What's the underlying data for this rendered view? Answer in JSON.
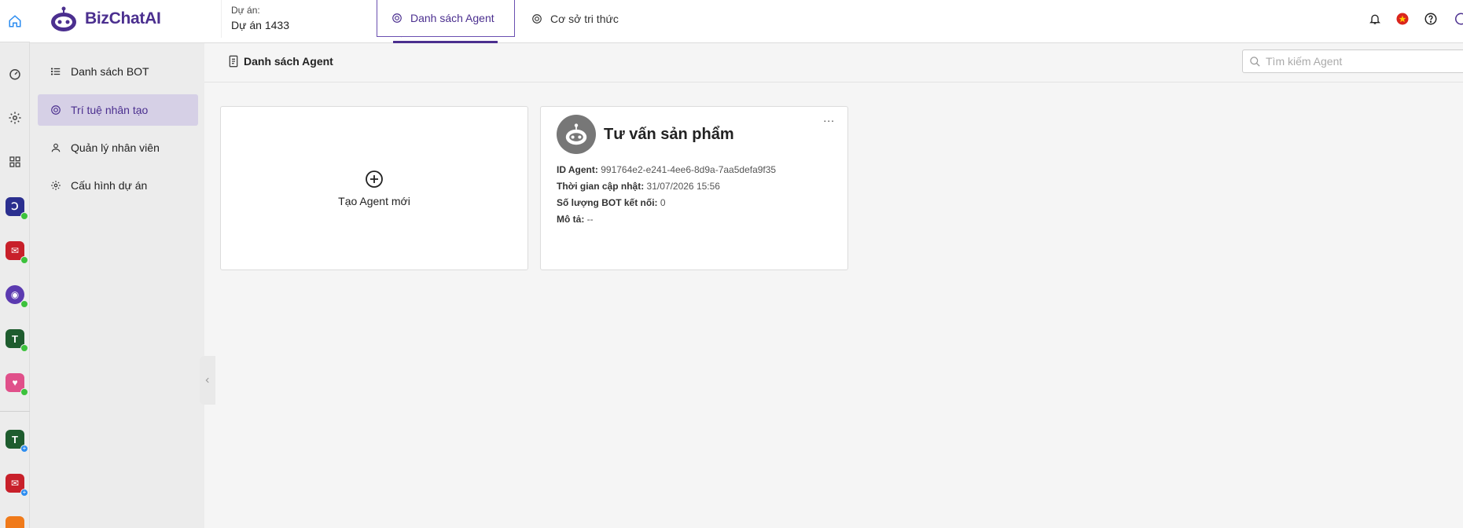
{
  "app": {
    "brand": "BizChatAI",
    "brand_prefix": "Biz",
    "brand_suffix": "ChatAI",
    "accent": "#4b2f8f"
  },
  "topbar": {
    "project_label": "Dự án:",
    "project_name": "Dự án 1433",
    "tabs": [
      {
        "label": "Danh sách Agent",
        "icon": "openai-icon",
        "active": true
      },
      {
        "label": "Cơ sở tri thức",
        "icon": "openai-icon",
        "active": false
      }
    ],
    "right_icons": [
      "bell-icon",
      "vietnam-flag-icon",
      "help-icon",
      "user-icon"
    ]
  },
  "rail": {
    "icons": [
      "home-icon",
      "dashboard-icon",
      "settings-icon",
      "grid-icon",
      "app-icon",
      "app-icon",
      "app-icon",
      "app-icon",
      "app-icon",
      "app-icon",
      "app-icon",
      "app-icon"
    ]
  },
  "sidebar": {
    "items": [
      {
        "label": "Danh sách BOT",
        "icon": "list-icon",
        "active": false
      },
      {
        "label": "Trí tuệ nhân tạo",
        "icon": "openai-icon",
        "active": true
      },
      {
        "label": "Quản lý nhân viên",
        "icon": "user-icon",
        "active": false
      },
      {
        "label": "Cấu hình dự án",
        "icon": "gear-icon",
        "active": false
      }
    ]
  },
  "main": {
    "title": "Danh sách Agent",
    "search_placeholder": "Tìm kiếm Agent",
    "new_agent_label": "Tạo Agent mới",
    "agents": [
      {
        "name": "Tư vấn sản phẩm",
        "id_label": "ID Agent:",
        "id_value": "991764e2-e241-4ee6-8d9a-7aa5defa9f35",
        "updated_label": "Thời gian cập nhật:",
        "updated_value": "31/07/2026 15:56",
        "bot_count_label": "Số lượng BOT kết nối:",
        "bot_count_value": "0",
        "desc_label": "Mô tả:",
        "desc_value": "--",
        "more": "..."
      }
    ]
  }
}
